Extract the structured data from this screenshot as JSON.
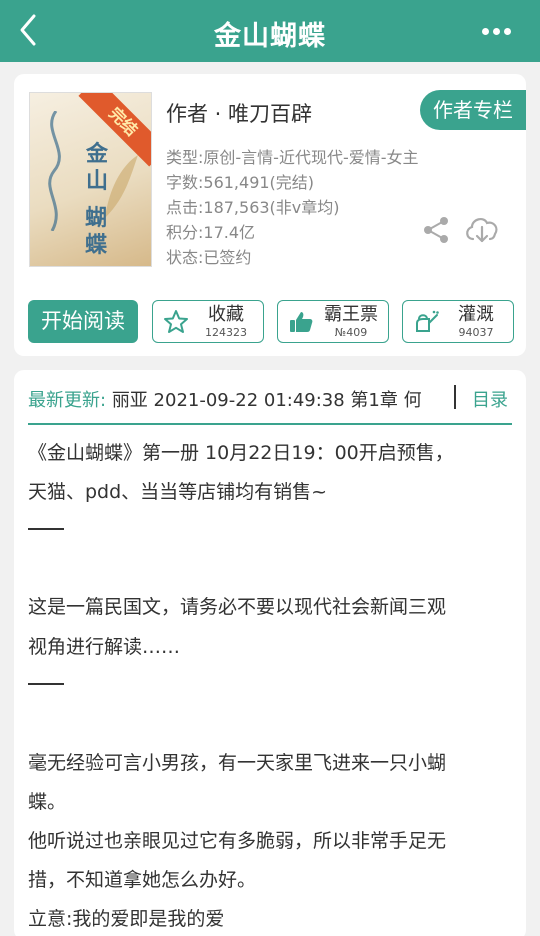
{
  "header": {
    "title": "金山蝴蝶"
  },
  "book": {
    "cover_title": "金山",
    "cover_title2": "蝴蝶",
    "badge": "完结",
    "author": "作者 · 唯刀百辟",
    "author_button": "作者专栏",
    "type": "类型:原创-言情-近代现代-爱情-女主",
    "words": "字数:561,491(完结)",
    "clicks": "点击:187,563(非v章均)",
    "score": "积分:17.4亿",
    "status": "状态:已签约"
  },
  "actions": {
    "read": "开始阅读",
    "collect": {
      "label": "收藏",
      "count": "124323",
      "icon": "star-icon"
    },
    "ticket": {
      "label": "霸王票",
      "count": "№409",
      "icon": "thumbs-up-icon"
    },
    "water": {
      "label": "灌溉",
      "count": "94037",
      "icon": "watering-can-icon"
    }
  },
  "update": {
    "label": "最新更新:",
    "value": "丽亚 2021-09-22 01:49:38   第1章 何",
    "toc": "目录"
  },
  "intro": {
    "l1": "《金山蝴蝶》第一册 10月22日19：00开启预售，",
    "l2": "天猫、pdd、当当等店铺均有销售~",
    "l3": "这是一篇民国文，请务必不要以现代社会新闻三观",
    "l4": "视角进行解读……",
    "l5": "毫无经验可言小男孩，有一天家里飞进来一只小蝴",
    "l6": "蝶。",
    "l7": "他听说过也亲眼见过它有多脆弱，所以非常手足无",
    "l8": "措，不知道拿她怎么办好。",
    "l9": "立意:我的爱即是我的爱"
  },
  "colors": {
    "accent": "#3aa38e",
    "badge": "#e05a2c"
  }
}
